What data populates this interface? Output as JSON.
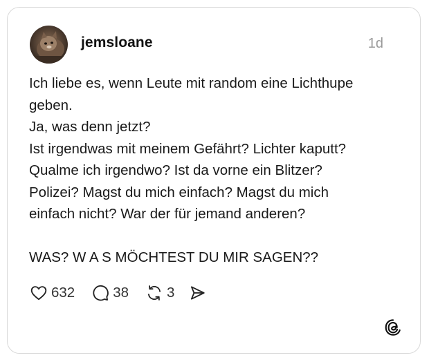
{
  "post": {
    "username": "jemsloane",
    "timestamp": "1d",
    "lines": [
      "Ich liebe es, wenn Leute mit random eine Lichthupe",
      "geben.",
      "Ja, was denn jetzt?",
      "Ist irgendwas mit meinem Gefährt? Lichter kaputt?",
      "Qualme ich irgendwo? Ist da vorne ein Blitzer?",
      "Polizei? Magst du mich einfach? Magst du mich",
      "einfach nicht? War der für jemand anderen?",
      "WAS? W A S MÖCHTEST DU MIR SAGEN??"
    ]
  },
  "actions": {
    "likes": "632",
    "replies": "38",
    "reposts": "3"
  },
  "icons": {
    "like": "heart-icon",
    "reply": "comment-icon",
    "repost": "repost-icon",
    "share": "send-icon",
    "brand": "threads-logo-icon"
  }
}
